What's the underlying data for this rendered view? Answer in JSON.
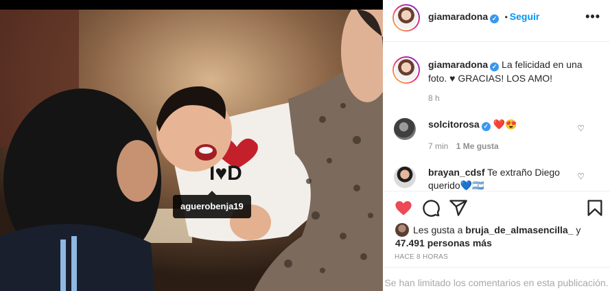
{
  "post": {
    "author": "giamaradona",
    "follow_label": "Seguir",
    "separator": "•",
    "more_label": "•••",
    "photo_tag": "aguerobenja19",
    "caption_author": "giamaradona",
    "caption_text": "La felicidad en una foto. ♥ GRACIAS! LOS AMO!",
    "caption_time": "8 h"
  },
  "comments": [
    {
      "user": "solcitorosa",
      "text": "❤️😍",
      "time": "7 min",
      "likes": "1 Me gusta"
    },
    {
      "user": "brayan_cdsf",
      "text": "Te extraño Diego querido💙🇦🇷"
    }
  ],
  "likes": {
    "prefix": "Les gusta a",
    "user": "bruja_de_almasencilla_",
    "joiner": "y",
    "count_text": "47.491 personas más"
  },
  "posted_ago": "HACE 8 HORAS",
  "comments_limited": "Se han limitado los comentarios en esta publicación.",
  "colors": {
    "accent": "#0095f6",
    "like_red": "#ed4956",
    "verified": "#3897f0"
  },
  "icons": [
    "heart-icon",
    "comment-icon",
    "share-icon",
    "bookmark-icon",
    "more-icon",
    "verified-icon"
  ]
}
